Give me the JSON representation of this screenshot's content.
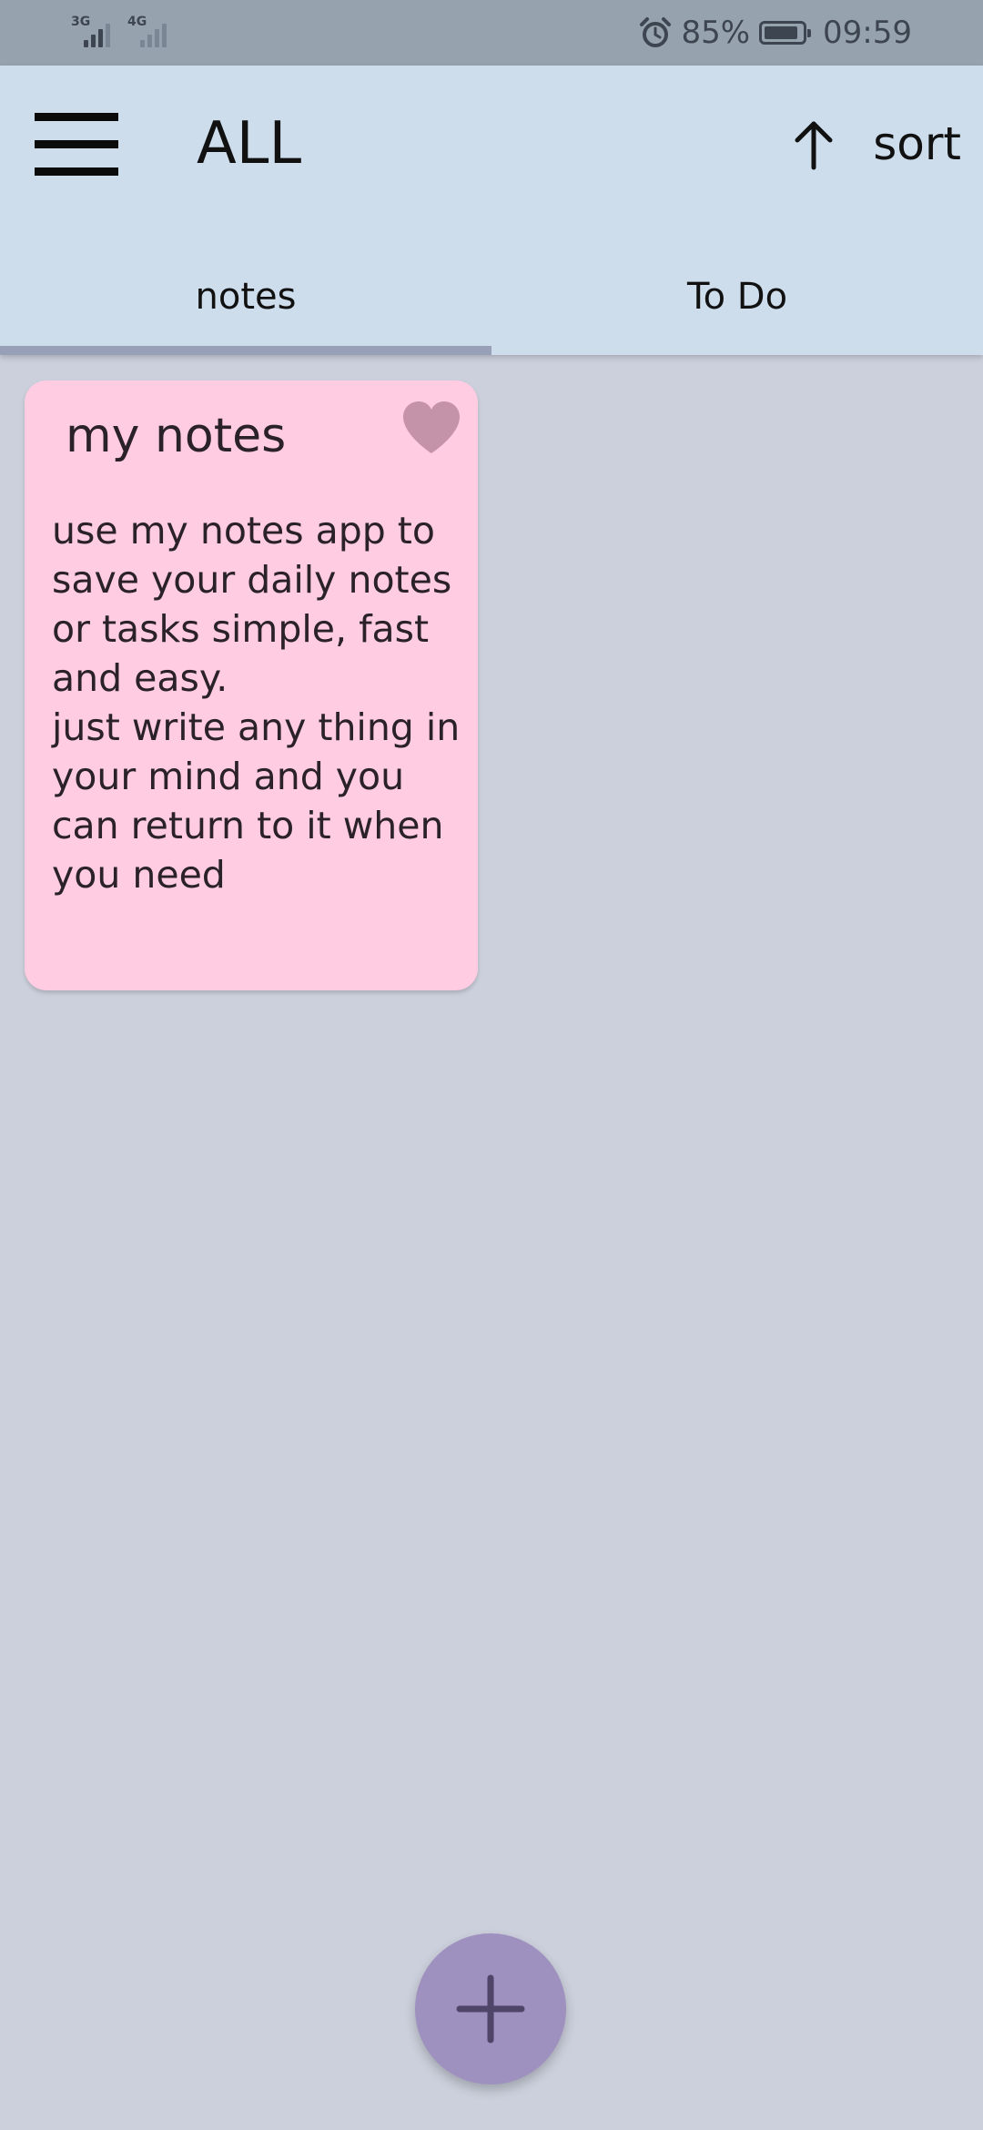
{
  "status_bar": {
    "sim1_type": "3G",
    "sim2_type": "4G",
    "battery_percent": "85%",
    "time": "09:59",
    "icons": [
      "alarm-icon",
      "battery-icon"
    ]
  },
  "app_bar": {
    "title": "ALL",
    "sort_label": "sort",
    "sort_direction": "ascending",
    "icons": [
      "menu-icon",
      "arrow-up-icon"
    ]
  },
  "tabs": [
    {
      "label": "notes",
      "selected": true
    },
    {
      "label": "To Do",
      "selected": false
    }
  ],
  "notes": [
    {
      "title": "my notes",
      "body": "use my notes app to save your daily notes or tasks simple, fast and easy.\njust write any thing in your mind and you can return to it when you need",
      "favorite": true,
      "color": "#FFCCE2",
      "favorite_icon": "heart-icon"
    }
  ],
  "fab": {
    "icon": "plus-icon",
    "color": "#9E90BF"
  },
  "colors": {
    "background": "#CCD0DC",
    "app_bar": "#CDDDEC",
    "status_bar": "#96A2AE",
    "tab_indicator": "#97A0B6"
  }
}
